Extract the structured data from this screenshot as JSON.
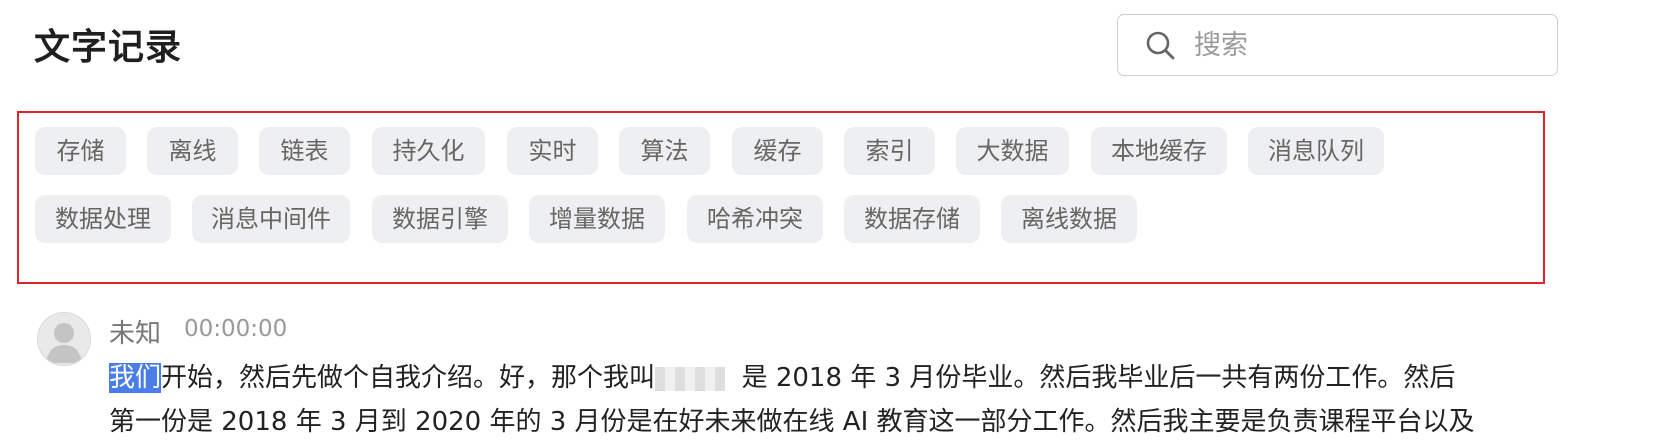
{
  "header": {
    "title": "文字记录"
  },
  "search": {
    "placeholder": "搜索",
    "icon": "search-icon"
  },
  "tags": [
    "存储",
    "离线",
    "链表",
    "持久化",
    "实时",
    "算法",
    "缓存",
    "索引",
    "大数据",
    "本地缓存",
    "消息队列",
    "数据处理",
    "消息中间件",
    "数据引擎",
    "增量数据",
    "哈希冲突",
    "数据存储",
    "离线数据"
  ],
  "entry": {
    "speaker": "未知",
    "timestamp": "00:00:00",
    "highlighted": "我们",
    "text_part1": "开始，然后先做个自我介绍。好，那个我叫",
    "text_part2": "是 2018 年 3 月份毕业。然后我毕业后一共有两份工作。然后",
    "text_line2": "第一份是 2018 年 3 月到 2020 年的 3 月份是在好未来做在线 AI 教育这一部分工作。然后我主要是负责课程平台以及"
  },
  "colors": {
    "tag_box_border": "#e0242e",
    "selection": "#4a7de8",
    "tag_bg": "#eeeff1"
  }
}
